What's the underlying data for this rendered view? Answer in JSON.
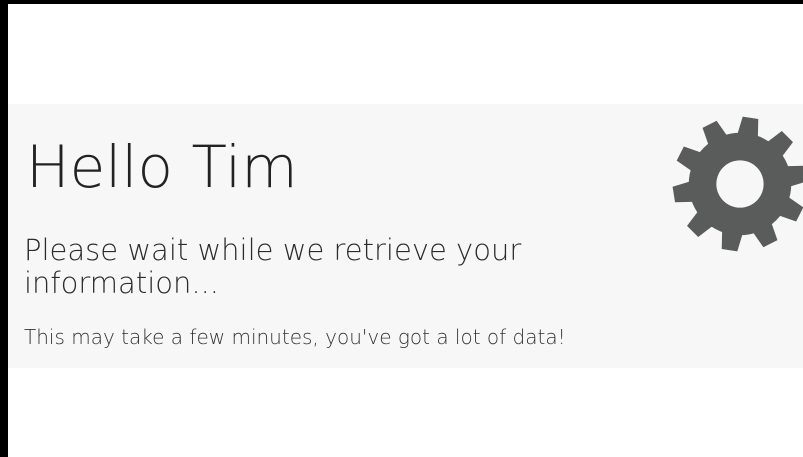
{
  "loading_panel": {
    "greeting": "Hello Tim",
    "message": "Please wait while we retrieve your information...",
    "note": "This may take a few minutes, you've got a lot of data!",
    "spinner_icon": "gear-icon"
  },
  "colors": {
    "panel_background": "#f7f7f7",
    "gear": "#5a5c5b",
    "text": "#222222",
    "border": "#000000"
  }
}
